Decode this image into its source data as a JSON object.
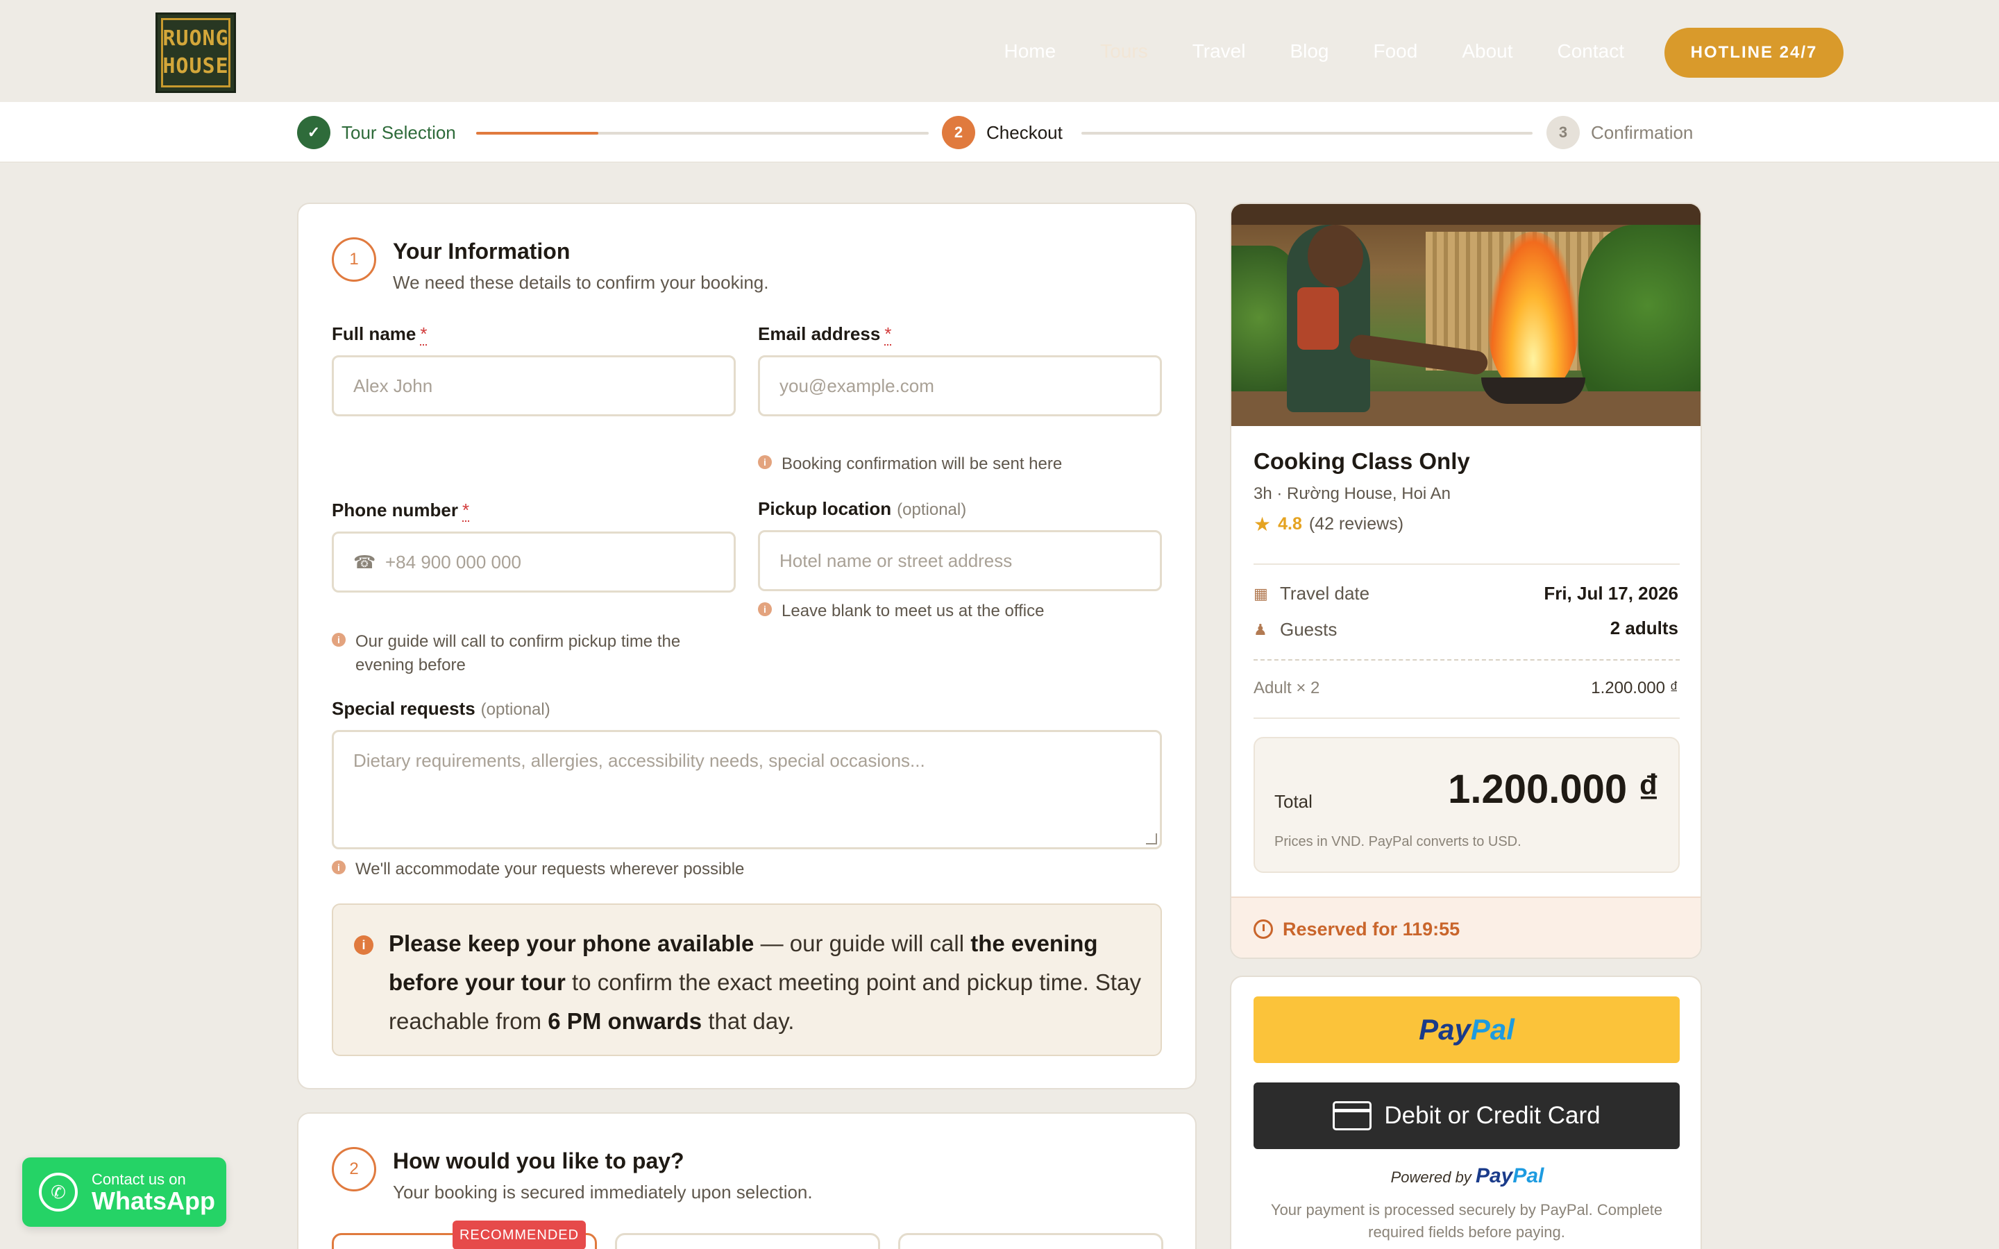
{
  "header": {
    "logo_lines": [
      "RUONG",
      "HOUSE"
    ],
    "nav": [
      "Home",
      "Tours",
      "Travel",
      "Blog",
      "Food",
      "About",
      "Contact"
    ],
    "hotline": "HOTLINE 24/7"
  },
  "stepper": {
    "steps": [
      {
        "num": "✓",
        "label": "Tour Selection"
      },
      {
        "num": "2",
        "label": "Checkout"
      },
      {
        "num": "3",
        "label": "Confirmation"
      }
    ],
    "progress_fraction": 0.27
  },
  "info": {
    "num": "1",
    "title": "Your Information",
    "subtitle": "We need these details to confirm your booking.",
    "full_name_label": "Full name",
    "full_name_placeholder": "Alex John",
    "email_label": "Email address",
    "email_placeholder": "you@example.com",
    "email_hint": "Booking confirmation will be sent here",
    "phone_label": "Phone number",
    "phone_placeholder": "+84 900 000 000",
    "phone_hint": "Our guide will call to confirm pickup time the evening before",
    "pickup_label": "Pickup location",
    "pickup_optional": "(optional)",
    "pickup_placeholder": "Hotel name or street address",
    "pickup_hint": "Leave blank to meet us at the office",
    "requests_label": "Special requests",
    "requests_optional": "(optional)",
    "requests_placeholder": "Dietary requirements, allergies, accessibility needs, special occasions...",
    "requests_hint": "We'll accommodate your requests wherever possible",
    "required_mark": "*",
    "notice": {
      "b1": "Please keep your phone available",
      "t1": " — our guide will call ",
      "b2": "the evening before your tour",
      "t2": " to confirm the exact meeting point and pickup time. Stay reachable from ",
      "b3": "6 PM onwards",
      "t3": " that day."
    }
  },
  "payment": {
    "num": "2",
    "title": "How would you like to pay?",
    "subtitle": "Your booking is secured immediately upon selection.",
    "badge": "RECOMMENDED"
  },
  "summary": {
    "title": "Cooking Class Only",
    "meta": "3h · Rường House, Hoi An",
    "rating": "4.8",
    "reviews": "(42 reviews)",
    "travel_date_label": "Travel date",
    "travel_date": "Fri, Jul 17, 2026",
    "guests_label": "Guests",
    "guests": "2 adults",
    "line_label": "Adult × 2",
    "line_value": "1.200.000 ₫",
    "total_label": "Total",
    "total_value": "1.200.000 ₫",
    "total_note": "Prices in VND. PayPal converts to USD.",
    "reserved": "Reserved for 119:55"
  },
  "paypal": {
    "btn_pay": "Pay",
    "btn_pal": "Pal",
    "card_btn": "Debit or Credit Card",
    "powered_by": "Powered by",
    "note": "Your payment is processed securely by PayPal. Complete required fields before paying."
  },
  "whatsapp": {
    "small": "Contact us on",
    "big": "WhatsApp"
  },
  "colors": {
    "accent": "#e07a3e",
    "success": "#2e6b3a",
    "hotline": "#d99a2b",
    "whatsapp": "#25d366",
    "paypal_yellow": "#fbc33a"
  }
}
